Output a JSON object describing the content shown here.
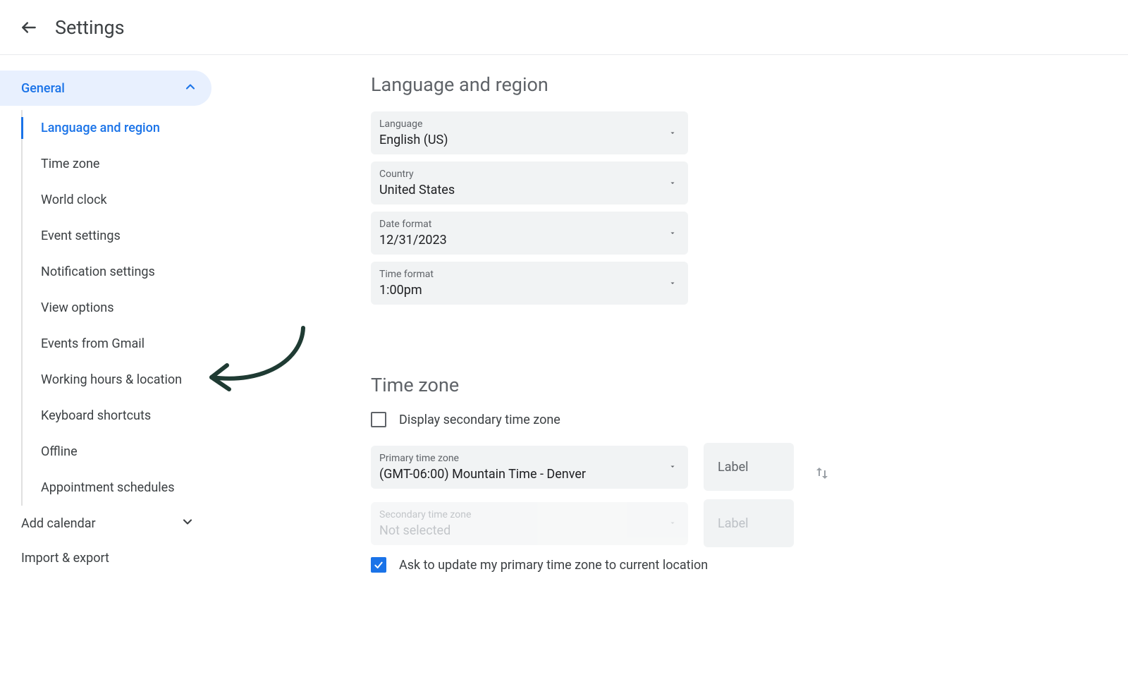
{
  "header": {
    "title": "Settings"
  },
  "sidebar": {
    "general": "General",
    "items": [
      "Language and region",
      "Time zone",
      "World clock",
      "Event settings",
      "Notification settings",
      "View options",
      "Events from Gmail",
      "Working hours & location",
      "Keyboard shortcuts",
      "Offline",
      "Appointment schedules"
    ],
    "add_calendar": "Add calendar",
    "import_export": "Import & export"
  },
  "main": {
    "lang_region_title": "Language and region",
    "language_label": "Language",
    "language_value": "English (US)",
    "country_label": "Country",
    "country_value": "United States",
    "dateformat_label": "Date format",
    "dateformat_value": "12/31/2023",
    "timeformat_label": "Time format",
    "timeformat_value": "1:00pm",
    "timezone_title": "Time zone",
    "secondary_tz_checkbox": "Display secondary time zone",
    "primary_tz_label": "Primary time zone",
    "primary_tz_value": "(GMT-06:00) Mountain Time - Denver",
    "label_placeholder": "Label",
    "secondary_tz_label": "Secondary time zone",
    "secondary_tz_value": "Not selected",
    "ask_update_checkbox": "Ask to update my primary time zone to current location"
  }
}
